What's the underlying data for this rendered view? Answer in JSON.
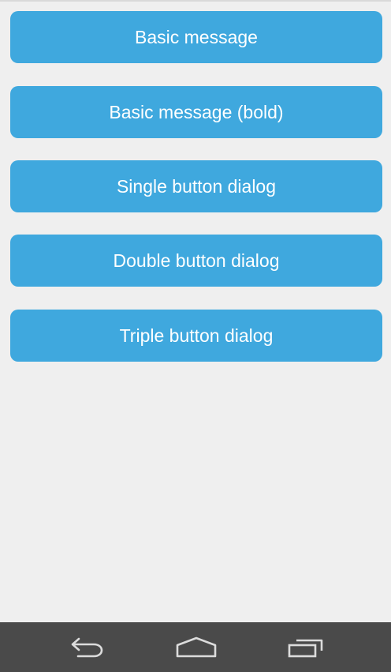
{
  "theme": {
    "background": "#efefef",
    "button_color": "#3fa8de",
    "button_text_color": "#ffffff",
    "navbar_color": "#4a4a4a",
    "nav_icon_color": "#dcdcdc"
  },
  "buttons": [
    {
      "label": "Basic message",
      "name": "basic-message-button"
    },
    {
      "label": "Basic message (bold)",
      "name": "basic-message-bold-button"
    },
    {
      "label": "Single button dialog",
      "name": "single-button-dialog-button"
    },
    {
      "label": "Double button dialog",
      "name": "double-button-dialog-button"
    },
    {
      "label": "Triple button dialog",
      "name": "triple-button-dialog-button"
    }
  ],
  "navigation_bar": {
    "icons": [
      "back-icon",
      "home-icon",
      "recents-icon"
    ]
  }
}
